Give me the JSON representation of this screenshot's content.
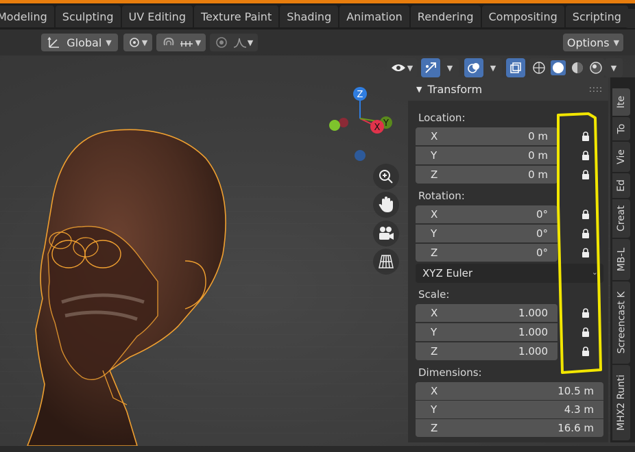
{
  "workspace_tabs": [
    "Modeling",
    "Sculpting",
    "UV Editing",
    "Texture Paint",
    "Shading",
    "Animation",
    "Rendering",
    "Compositing",
    "Scripting"
  ],
  "header": {
    "orientation_label": "Global",
    "options_label": "Options"
  },
  "gizmo": {
    "z_label": "Z",
    "x_label": "X",
    "y_label": "Y"
  },
  "transform": {
    "title": "Transform",
    "location_label": "Location:",
    "location": [
      {
        "axis": "X",
        "value": "0 m"
      },
      {
        "axis": "Y",
        "value": "0 m"
      },
      {
        "axis": "Z",
        "value": "0 m"
      }
    ],
    "rotation_label": "Rotation:",
    "rotation": [
      {
        "axis": "X",
        "value": "0°"
      },
      {
        "axis": "Y",
        "value": "0°"
      },
      {
        "axis": "Z",
        "value": "0°"
      }
    ],
    "rotation_mode": "XYZ Euler",
    "scale_label": "Scale:",
    "scale": [
      {
        "axis": "X",
        "value": "1.000"
      },
      {
        "axis": "Y",
        "value": "1.000"
      },
      {
        "axis": "Z",
        "value": "1.000"
      }
    ],
    "dimensions_label": "Dimensions:",
    "dimensions": [
      {
        "axis": "X",
        "value": "10.5 m"
      },
      {
        "axis": "Y",
        "value": "4.3 m"
      },
      {
        "axis": "Z",
        "value": "16.6 m"
      }
    ]
  },
  "sidebar_tabs": [
    "Ite",
    "To",
    "Vie",
    "Ed",
    "Creat",
    "MB-L",
    "Screencast K",
    "MHX2 Runti"
  ],
  "colors": {
    "accent": "#e87d0d",
    "selection_outline": "#f0a030",
    "highlight": "#f2e600",
    "active_blue": "#4772b3"
  }
}
